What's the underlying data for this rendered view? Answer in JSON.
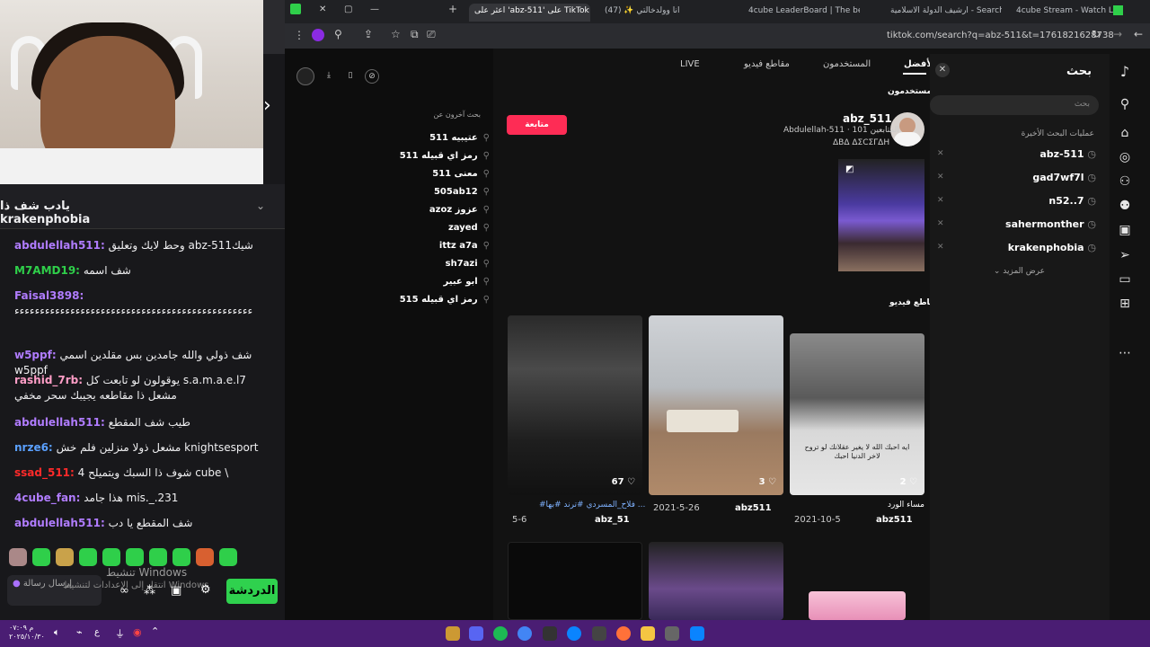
{
  "chat": {
    "pinned_text": "يادب شف ذا krakenphobia",
    "messages": [
      {
        "user": "abdulellah511:",
        "color": "#b07cff",
        "text": "وحط لايك وتعليق abz-511شيك"
      },
      {
        "user": "M7AMD19:",
        "color": "#2fcf4a",
        "text": "شف اسمه"
      },
      {
        "user": "Faisal3898:",
        "color": "#b07cff",
        "text": "ءءءءءءءءءءءءءءءءءءءءءءءءءءءءءءءءءءءءءءءءءءءءءءء"
      },
      {
        "user": "w5ppf:",
        "color": "#b07cff",
        "text": "شف ذولي والله جامدين بس مقلدين اسمي w5ppf"
      },
      {
        "user": "rashid_7rb:",
        "color": "#ff9ec7",
        "text": "يوقولون لو تابعت كل s.a.m.a.e.l7 مشعل ذا مقاطعه يجيبك سحر مخفي"
      },
      {
        "user": "abdulellah511:",
        "color": "#b07cff",
        "text": "طيب شف المقطع"
      },
      {
        "user": "nrze6:",
        "color": "#5aa0ff",
        "text": "مشعل ذولا منزلين فلم خش knightsesport"
      },
      {
        "user": "ssad_511:",
        "color": "#ff2a2a",
        "text": "شوف ذا السبك ويتميلح 4 cube \\"
      },
      {
        "user": "4cube_fan:",
        "color": "#b07cff",
        "text": "هذا جامد mis._.231"
      },
      {
        "user": "abdulellah511:",
        "color": "#b07cff",
        "text": "شف المقطع يا دب"
      }
    ],
    "send_label": "الدردشة",
    "input_placeholder": "إرسال رسالة",
    "watermark": "تنشيط Windows",
    "watermark_sub": "انتقل إلى الإعدادات لتنشيط Windows"
  },
  "browser": {
    "tabs": [
      {
        "label": "اعثر على 'abz-511' على TikTok",
        "active": true
      },
      {
        "label": "انا وولدخالتي ✨ (47)",
        "active": false
      },
      {
        "label": "4cube LeaderBoard | The best",
        "active": false
      },
      {
        "label": "ارشيف الدولة الاسلامية - Search",
        "active": false
      },
      {
        "label": "4cube Stream - Watch Live on",
        "active": false
      }
    ],
    "url": "tiktok.com/search?q=abz-511&t=1761821628738"
  },
  "tiktok": {
    "search_title": "بحث",
    "search_placeholder": "بحث",
    "recent_title": "عمليات البحث الأخيرة",
    "recent": [
      "abz-511",
      "gad7wf7l",
      "n52..7",
      "sahermonther",
      "krakenphobia"
    ],
    "show_more": "عرض المزيد",
    "tabs": [
      "الأفضل",
      "المستخدمون",
      "مقاطع فيديو",
      "LIVE"
    ],
    "users_heading": "المستخدمون",
    "user": {
      "name": "abz_511",
      "sub": "Abdulellah-511 · 101 المتابعين",
      "bio": "ΔBΔ ΔΣCΣΓΔΗ",
      "follow": "متابعة"
    },
    "others_heading": "بحث آخرون عن",
    "others": [
      "511 عتيبيه",
      "511 رمز اي قبيله",
      "511 معنى",
      "505ab12",
      "azoz عزوز",
      "zayed",
      "ittz a7a",
      "sh7azi",
      "ابو عبير",
      "515 رمز اي قبيله"
    ],
    "videos_heading": "مقاطع فيديو",
    "videos": [
      {
        "likes": "67",
        "desc": "#فلاح_المسردي #ترند #بها ...",
        "date": "5-6",
        "author": "abz_51"
      },
      {
        "likes": "3",
        "desc": "",
        "date": "2021-5-26",
        "author": "abz511"
      },
      {
        "likes": "2",
        "desc": "مساء الورد",
        "date": "2021-10-5",
        "author": "abz511"
      }
    ],
    "video3_caption": "ايه احبك الله لا يغير عقلانك لو تروح لاخر الدنيا احبك"
  },
  "clock": {
    "time": "م ٠٧:٠٩",
    "date": "٢٠٢٥/١٠/٣٠"
  }
}
